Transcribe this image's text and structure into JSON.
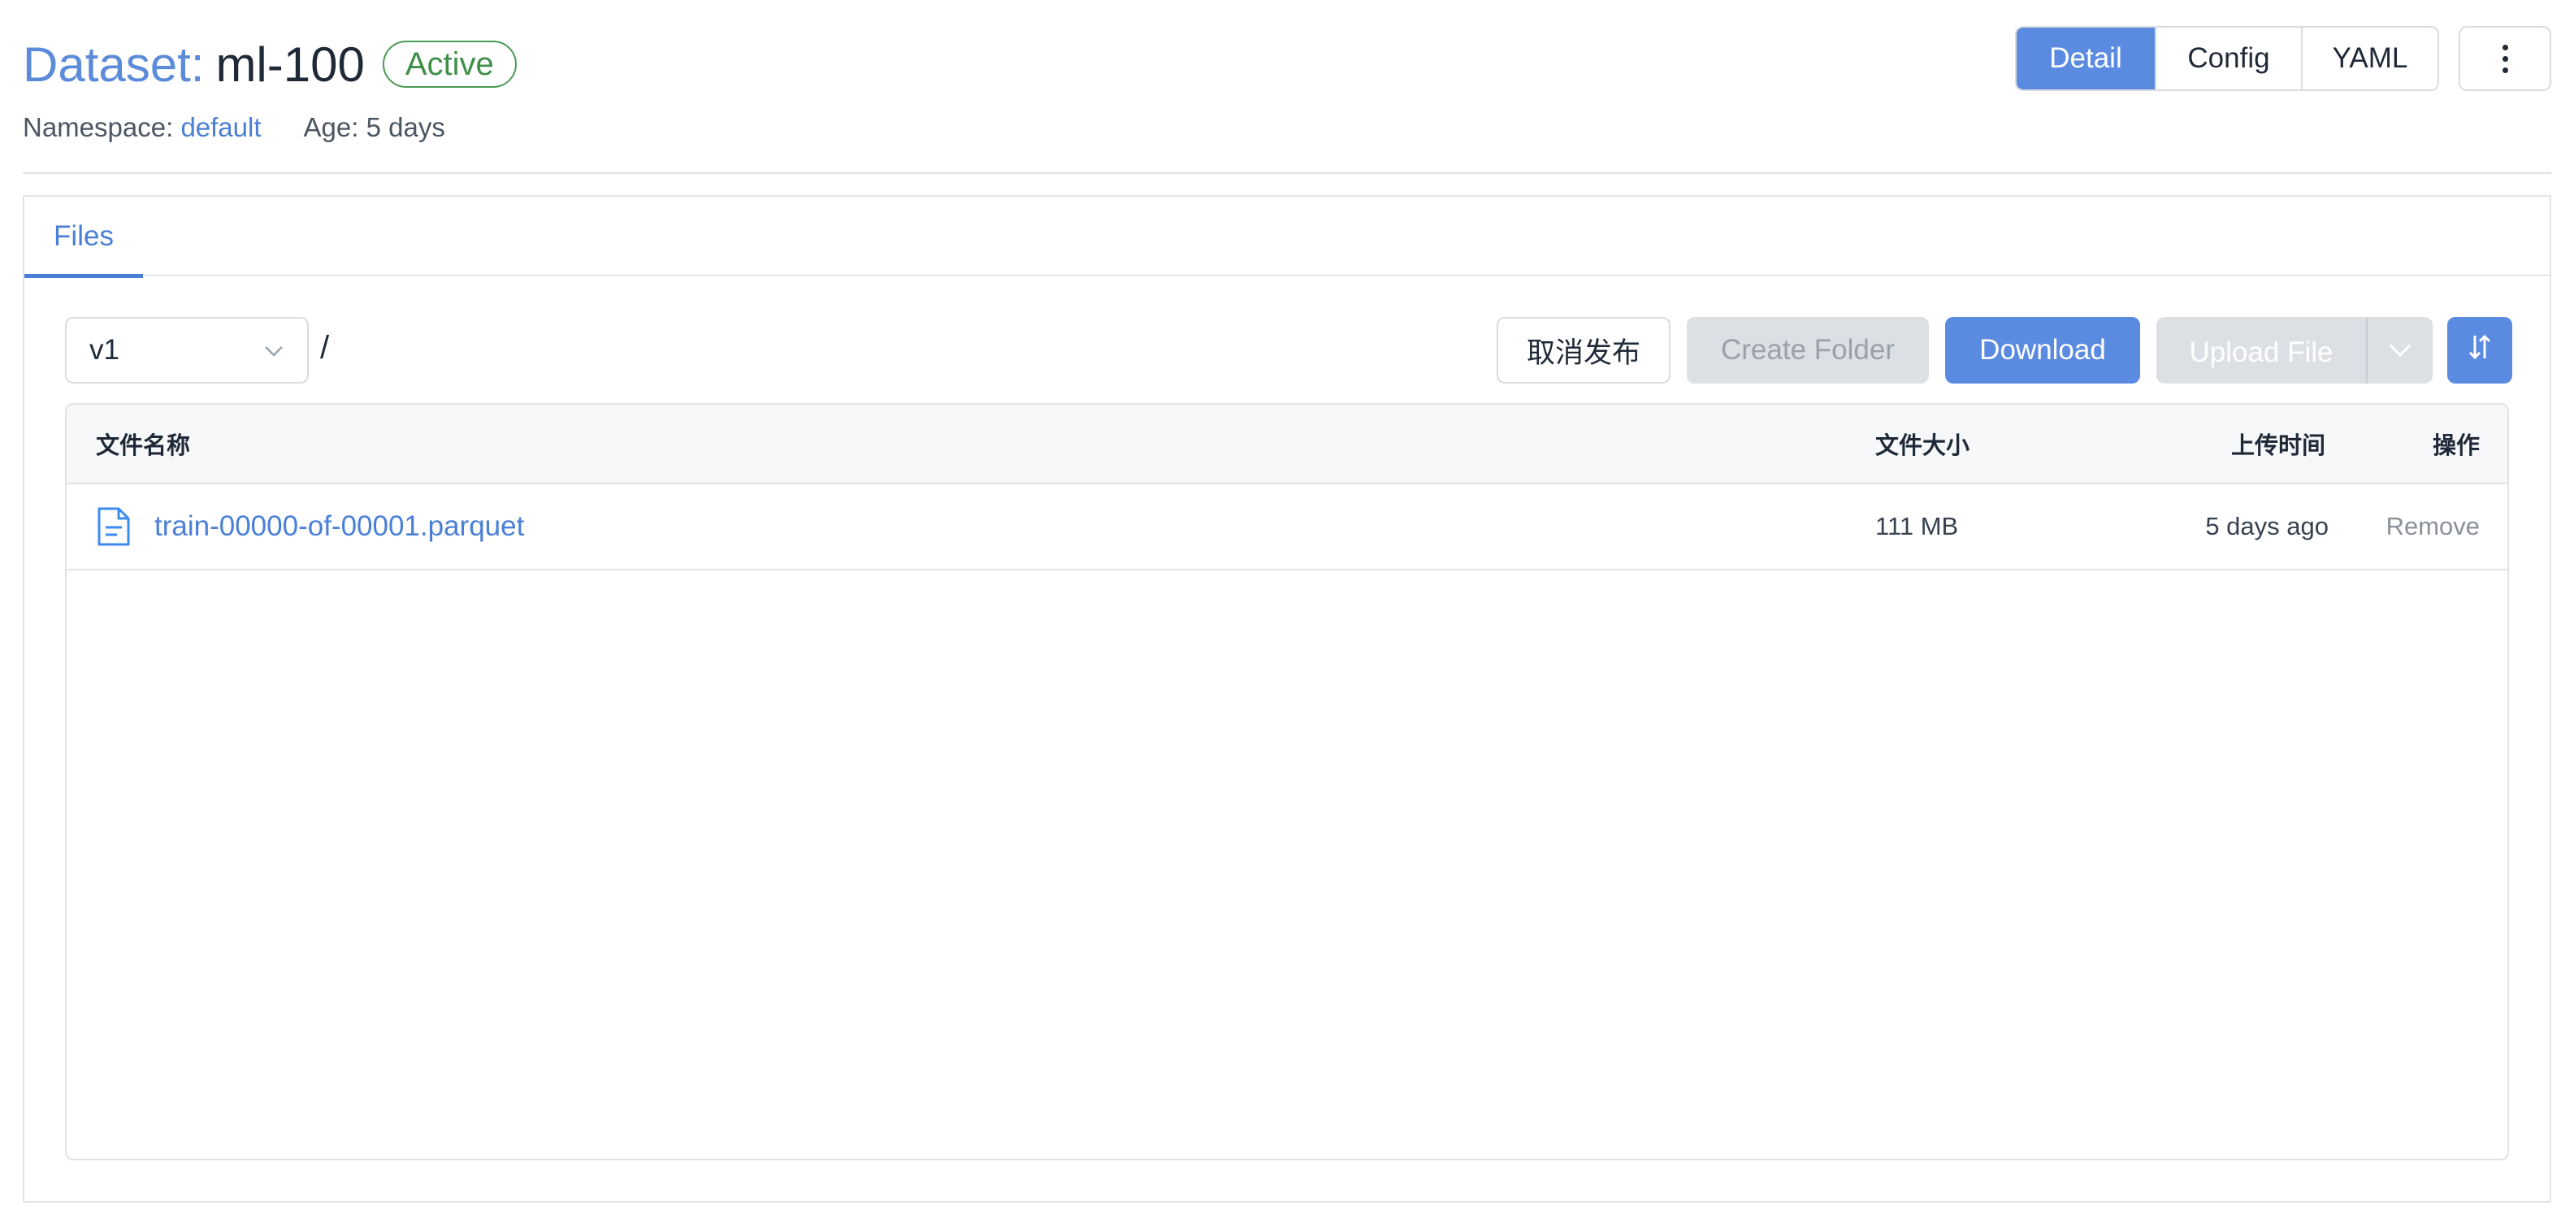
{
  "header": {
    "kind_label": "Dataset:",
    "name": "ml-100",
    "status": "Active",
    "namespace_label": "Namespace:",
    "namespace_value": "default",
    "age_text": "Age: 5 days"
  },
  "view_toggle": {
    "detail": "Detail",
    "config": "Config",
    "yaml": "YAML",
    "active": "Detail"
  },
  "tabs": [
    {
      "label": "Files",
      "active": true
    }
  ],
  "toolbar": {
    "version_value": "v1",
    "path_separator": "/",
    "unpublish_label": "取消发布",
    "create_folder_label": "Create Folder",
    "download_label": "Download",
    "upload_label": "Upload File"
  },
  "table": {
    "columns": {
      "name": "文件名称",
      "size": "文件大小",
      "time": "上传时间",
      "ops": "操作"
    },
    "rows": [
      {
        "name": "train-00000-of-00001.parquet",
        "size": "111 MB",
        "time": "5 days ago",
        "action": "Remove"
      }
    ]
  },
  "colors": {
    "accent": "#5b8be0",
    "link": "#4a7fd6",
    "status_green": "#3f8f48",
    "disabled_bg": "#dcdfe4"
  },
  "icons": {
    "more": "kebab-vertical-icon",
    "select": "chevron-down-icon",
    "sort": "sort-arrows-icon",
    "file": "file-document-icon"
  }
}
